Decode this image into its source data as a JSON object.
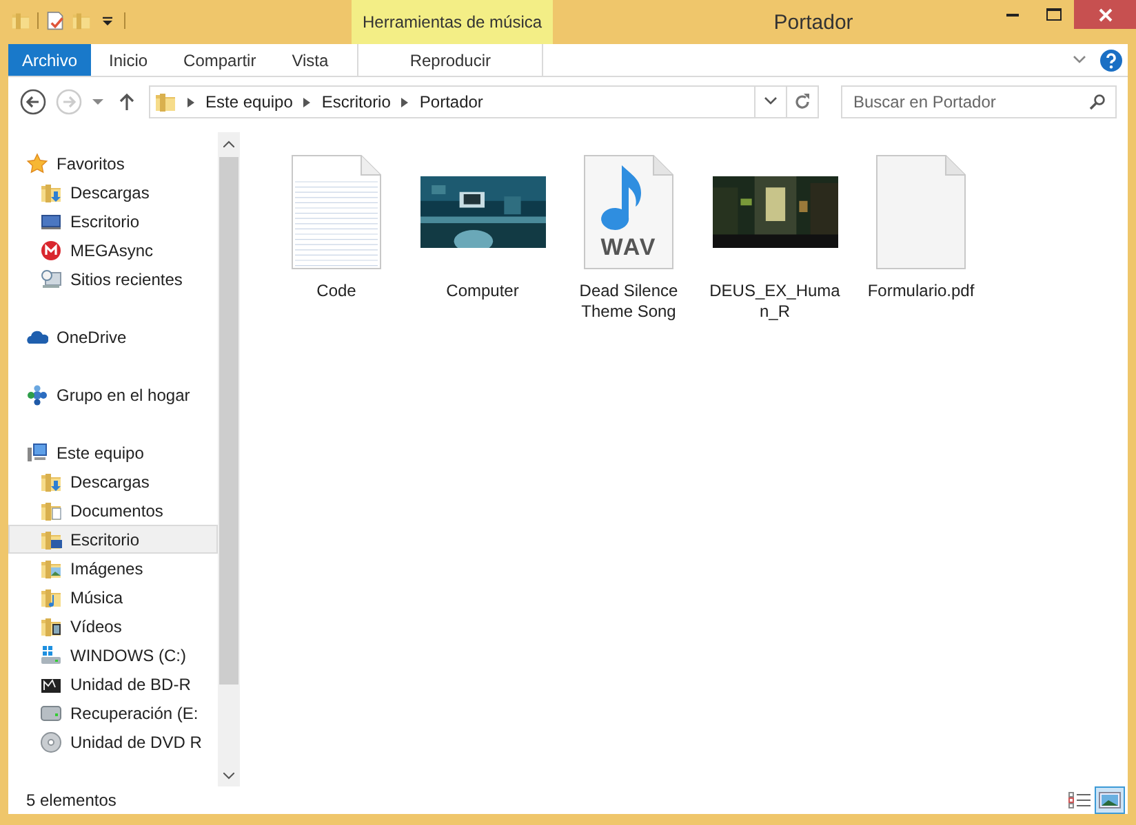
{
  "window": {
    "title": "Portador",
    "context_tab": "Herramientas de música"
  },
  "ribbon_tabs": [
    {
      "label": "Archivo",
      "kind": "file"
    },
    {
      "label": "Inicio",
      "kind": "tab"
    },
    {
      "label": "Compartir",
      "kind": "tab"
    },
    {
      "label": "Vista",
      "kind": "tab"
    },
    {
      "label": "Reproducir",
      "kind": "context"
    }
  ],
  "address": {
    "path": [
      "Este equipo",
      "Escritorio",
      "Portador"
    ]
  },
  "search": {
    "placeholder": "Buscar en Portador"
  },
  "nav": [
    {
      "label": "Favoritos",
      "kind": "star",
      "selected": false,
      "children": [
        {
          "label": "Descargas",
          "kind": "downloads",
          "selected": false
        },
        {
          "label": "Escritorio",
          "kind": "desktop",
          "selected": false
        },
        {
          "label": "MEGAsync",
          "kind": "mega",
          "selected": false
        },
        {
          "label": "Sitios recientes",
          "kind": "recent",
          "selected": false
        }
      ]
    },
    {
      "label": "OneDrive",
      "kind": "cloud",
      "selected": false
    },
    {
      "label": "Grupo en el hogar",
      "kind": "homegroup",
      "selected": false
    },
    {
      "label": "Este equipo",
      "kind": "computer",
      "selected": false,
      "children": [
        {
          "label": "Descargas",
          "kind": "downloads",
          "selected": false
        },
        {
          "label": "Documentos",
          "kind": "documents",
          "selected": false
        },
        {
          "label": "Escritorio",
          "kind": "desktop-folder",
          "selected": true
        },
        {
          "label": "Imágenes",
          "kind": "pictures",
          "selected": false
        },
        {
          "label": "Música",
          "kind": "music",
          "selected": false
        },
        {
          "label": "Vídeos",
          "kind": "videos",
          "selected": false
        },
        {
          "label": "WINDOWS (C:)",
          "kind": "system-drive",
          "selected": false
        },
        {
          "label": "Unidad de BD-R",
          "kind": "bd",
          "selected": false
        },
        {
          "label": "Recuperación (E:",
          "kind": "drive",
          "selected": false
        },
        {
          "label": "Unidad de DVD R",
          "kind": "dvd",
          "selected": false
        }
      ]
    }
  ],
  "files": [
    {
      "name": "Code",
      "kind": "text"
    },
    {
      "name": "Computer",
      "kind": "picture"
    },
    {
      "name": "Dead Silence Theme Song",
      "kind": "audio",
      "badge": "WAV"
    },
    {
      "name": "DEUS_EX_Human_R",
      "kind": "picture"
    },
    {
      "name": "Formulario.pdf",
      "kind": "blank"
    }
  ],
  "status_bar": {
    "count": "5 elementos",
    "views": [
      {
        "kind": "details",
        "selected": false
      },
      {
        "kind": "large-icons",
        "selected": true
      }
    ]
  }
}
